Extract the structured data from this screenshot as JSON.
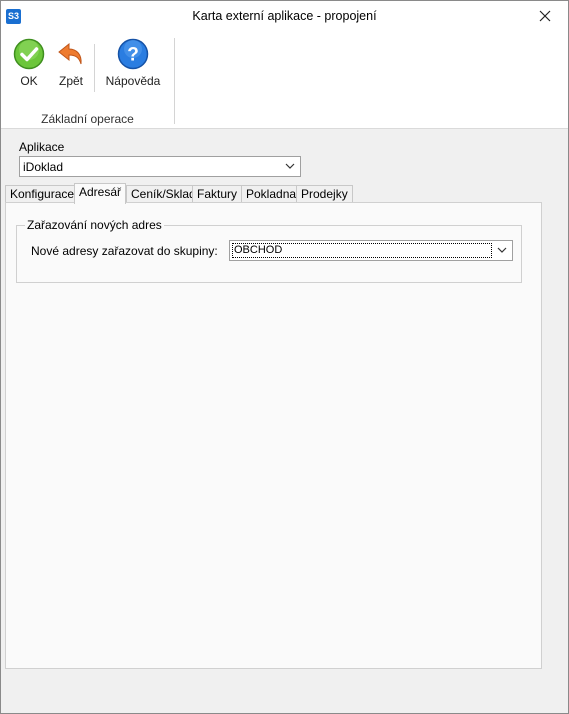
{
  "window": {
    "title": "Karta externí aplikace - propojení",
    "app_icon_text": "S3"
  },
  "ribbon": {
    "buttons": [
      {
        "label": "OK",
        "icon": "check-circle-icon",
        "color": "#5cb82e"
      },
      {
        "label": "Zpět",
        "icon": "undo-arrow-icon",
        "color": "#e8752a"
      },
      {
        "label": "Nápověda",
        "icon": "help-question-icon",
        "color": "#1f6fd6"
      }
    ],
    "group_label": "Základní operace"
  },
  "application": {
    "label": "Aplikace",
    "selected": "iDoklad"
  },
  "tabs": [
    {
      "label": "Konfigurace",
      "active": false
    },
    {
      "label": "Adresář",
      "active": true
    },
    {
      "label": "Ceník/Sklad",
      "active": false
    },
    {
      "label": "Faktury",
      "active": false
    },
    {
      "label": "Pokladna",
      "active": false
    },
    {
      "label": "Prodejky",
      "active": false
    }
  ],
  "adresar": {
    "group_title": "Zařazování nových adres",
    "group_field_label": "Nové adresy zařazovat do skupiny:",
    "group_field_value": "OBCHOD"
  }
}
